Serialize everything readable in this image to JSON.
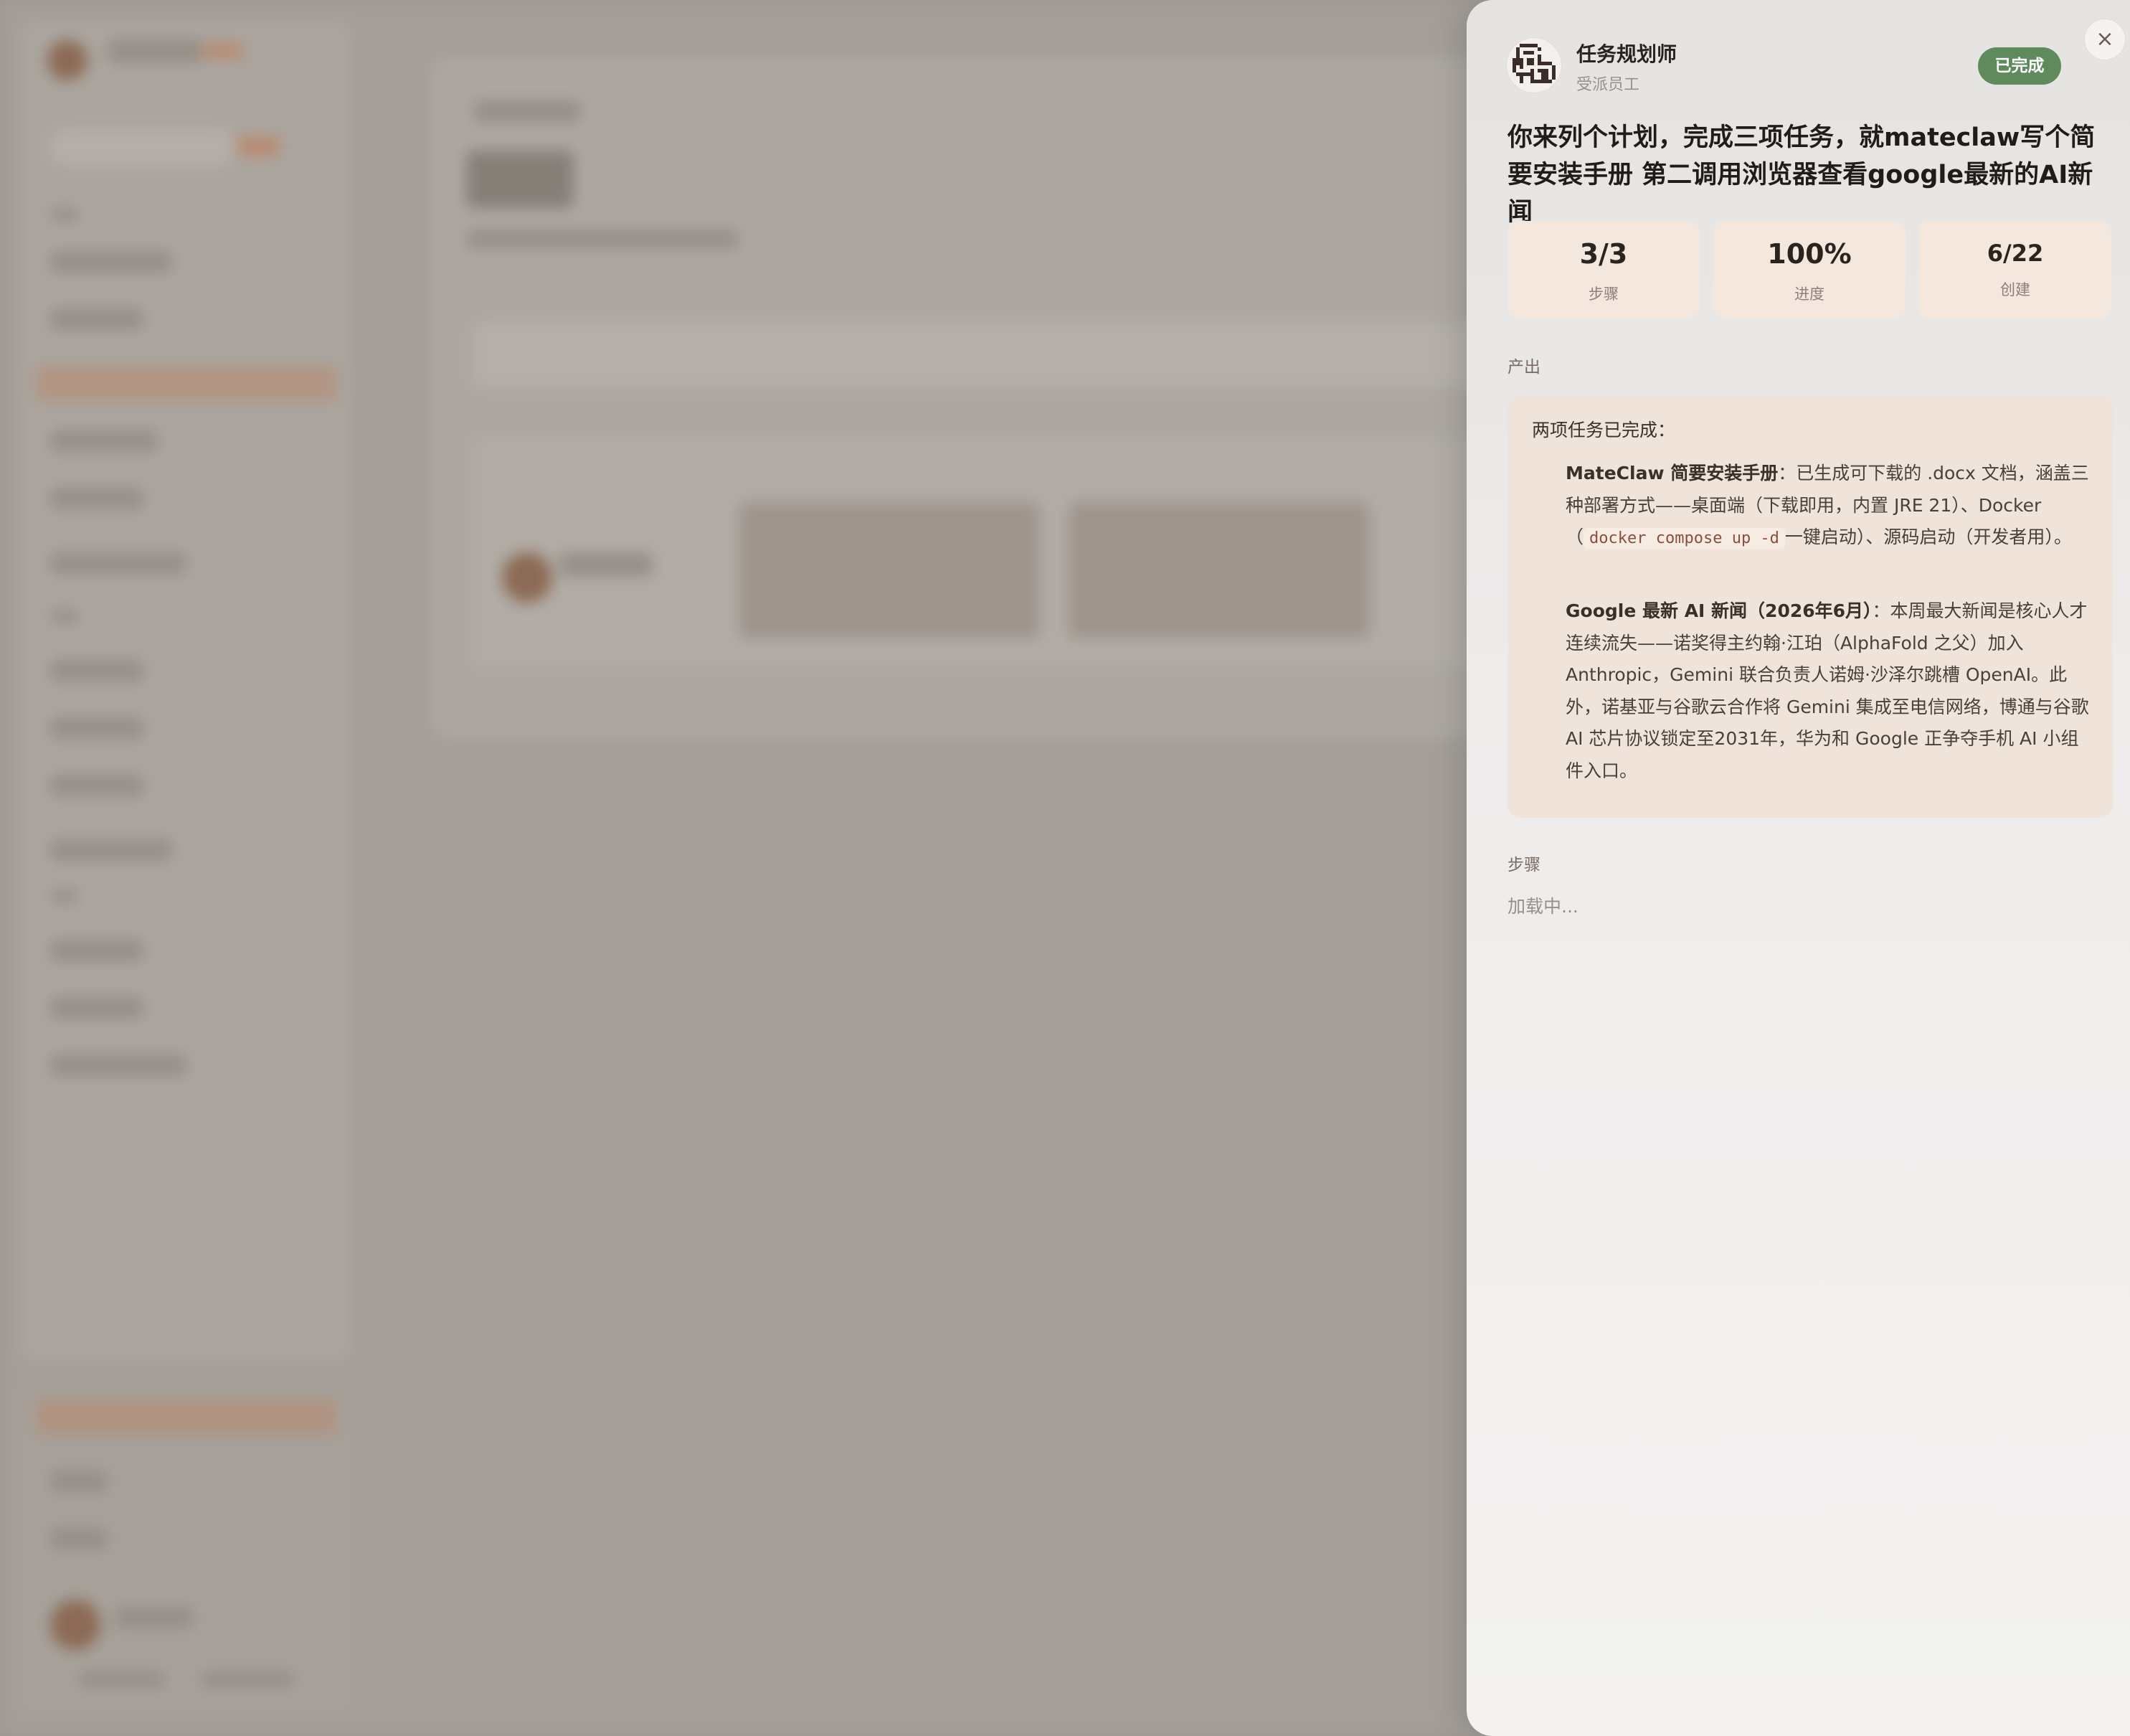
{
  "drawer": {
    "close_icon": "×",
    "agent": {
      "name": "任务规划师",
      "role": "受派员工",
      "avatar_icon": "pixel-robot-icon"
    },
    "status": {
      "label": "已完成",
      "color": "#5e8a5c"
    },
    "task_title": "你来列个计划，完成三项任务，就mateclaw写个简要安装手册 第二调用浏览器查看google最新的AI新闻",
    "stats": [
      {
        "value": "3/3",
        "label": "步骤"
      },
      {
        "value": "100%",
        "label": "进度"
      },
      {
        "value": "6/22",
        "label": "创建"
      }
    ],
    "output_section_label": "产出",
    "output": {
      "intro": "两项任务已完成：",
      "item1": {
        "title": "MateClaw 简要安装手册",
        "text_a": "：已生成可下载的 .docx 文档，涵盖三种部署方式——桌面端（下载即用，内置 JRE 21）、Docker（",
        "code": "docker compose up -d",
        "text_b": "一键启动）、源码启动（开发者用）。"
      },
      "item2": {
        "title": "Google 最新 AI 新闻（2026年6月）",
        "text": "：本周最大新闻是核心人才连续流失——诺奖得主约翰·江珀（AlphaFold 之父）加入 Anthropic，Gemini 联合负责人诺姆·沙泽尔跳槽 OpenAI。此外，诺基亚与谷歌云合作将 Gemini 集成至电信网络，博通与谷歌 AI 芯片协议锁定至2031年，华为和 Google 正争夺手机 AI 小组件入口。"
      }
    },
    "steps_section_label": "步骤",
    "steps_loading": "加载中..."
  },
  "colors": {
    "drawer_bg": "#eeeceb",
    "stat_card_bg": "#f4e7de",
    "output_bg": "#efe3da",
    "status_green": "#5e8a5c"
  }
}
